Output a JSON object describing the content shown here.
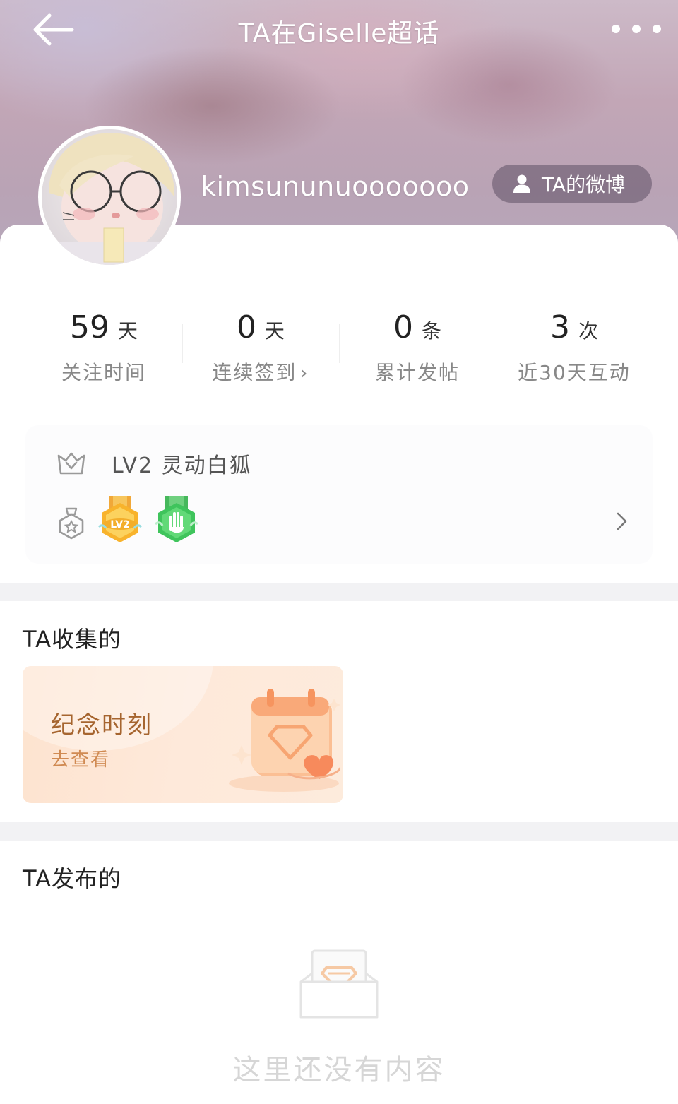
{
  "header": {
    "title": "TA在Giselle超话",
    "back_icon": "arrow-left-icon",
    "more_icon": "more-dots-icon"
  },
  "profile": {
    "username": "kimsununuooooooo",
    "weibo_button_label": "TA的微博"
  },
  "stats": [
    {
      "value": "59",
      "unit": "天",
      "label": "关注时间"
    },
    {
      "value": "0",
      "unit": "天",
      "label": "连续签到",
      "chevron": "›"
    },
    {
      "value": "0",
      "unit": "条",
      "label": "累计发帖"
    },
    {
      "value": "3",
      "unit": "次",
      "label": "近30天互动"
    }
  ],
  "level": {
    "label": "LV2 灵动白狐",
    "badges": [
      {
        "name": "lv2-badge",
        "text": "LV2",
        "color": "#f7b52e"
      },
      {
        "name": "hand-badge",
        "color": "#4fcf6a"
      }
    ]
  },
  "collected": {
    "title": "TA收集的",
    "card_title": "纪念时刻",
    "card_subtitle": "去查看"
  },
  "posted": {
    "title": "TA发布的",
    "empty_text": "这里还没有内容"
  },
  "colors": {
    "accent_orange": "#a6652f",
    "separator": "#f2f2f4"
  }
}
